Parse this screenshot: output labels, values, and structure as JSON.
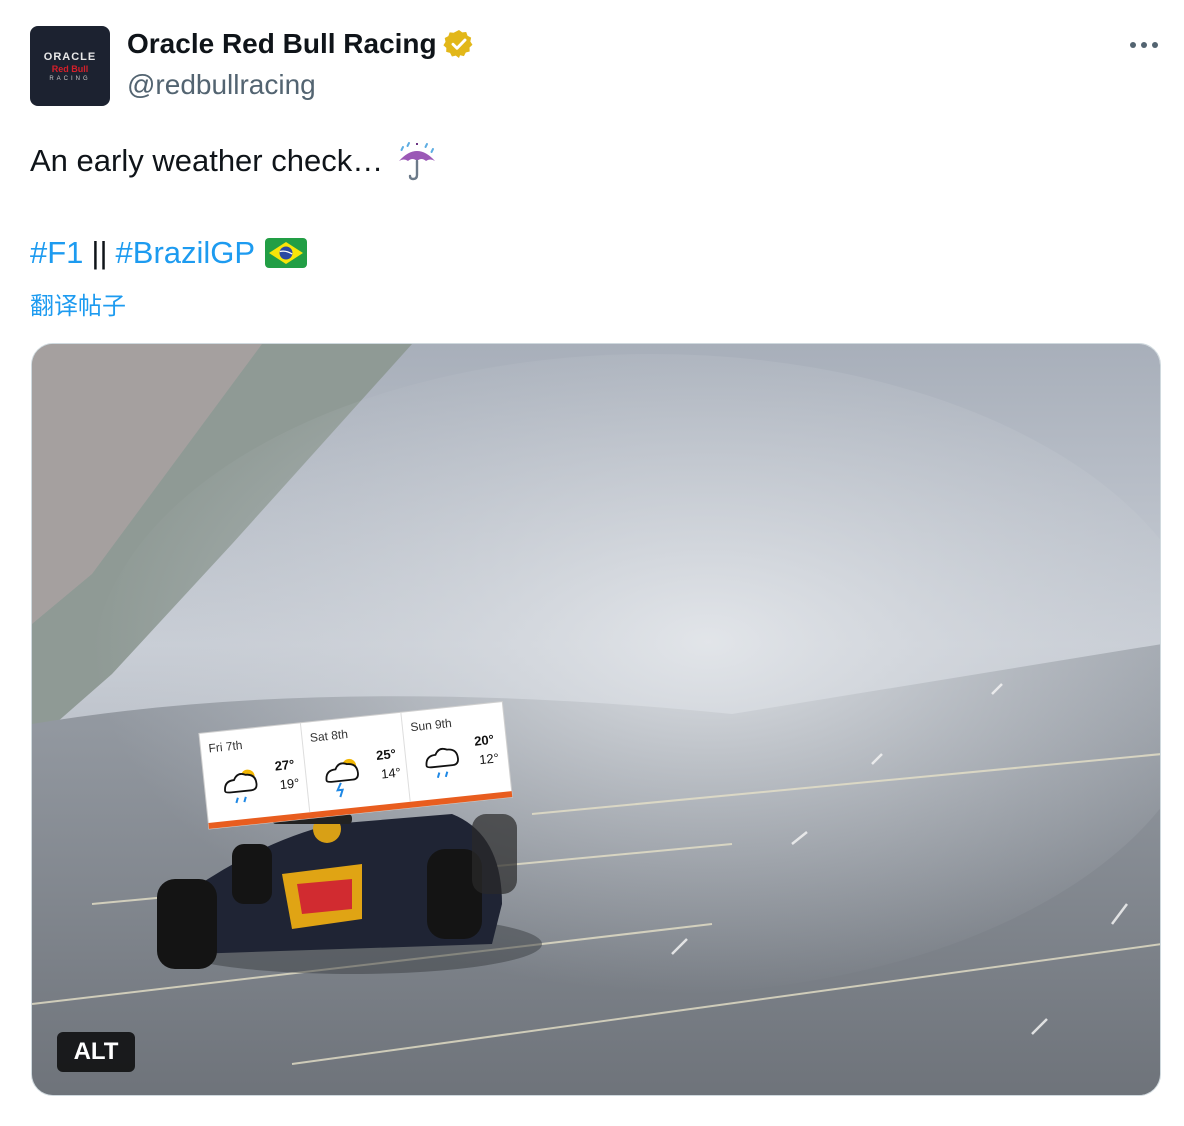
{
  "author": {
    "display_name": "Oracle Red Bull Racing",
    "handle": "@redbullracing",
    "avatar": {
      "line1": "ORACLE",
      "line2": "Red Bull",
      "line3": "RACING"
    },
    "verified_icon": "gold-verified-badge-icon",
    "verified_color": "#e2b719"
  },
  "menu": {
    "icon": "more-options-icon"
  },
  "tweet": {
    "text": "An early weather check…",
    "emoji": "umbrella-with-rain-icon",
    "hashtag_1": "#F1",
    "separator": "||",
    "hashtag_2": "#BrazilGP",
    "flag": "brazil-flag-icon",
    "translate_link": "翻译帖子"
  },
  "media": {
    "alt_badge": "ALT",
    "forecast": [
      {
        "day": "Fri 7th",
        "high": "27°",
        "low": "19°",
        "icon": "rain-sun-cloud-icon"
      },
      {
        "day": "Sat 8th",
        "high": "25°",
        "low": "14°",
        "icon": "thunder-rain-sun-icon"
      },
      {
        "day": "Sun 9th",
        "high": "20°",
        "low": "12°",
        "icon": "rain-cloud-icon"
      }
    ]
  },
  "colors": {
    "link": "#1d9bf0",
    "text": "#0f1419",
    "secondary": "#536471"
  }
}
